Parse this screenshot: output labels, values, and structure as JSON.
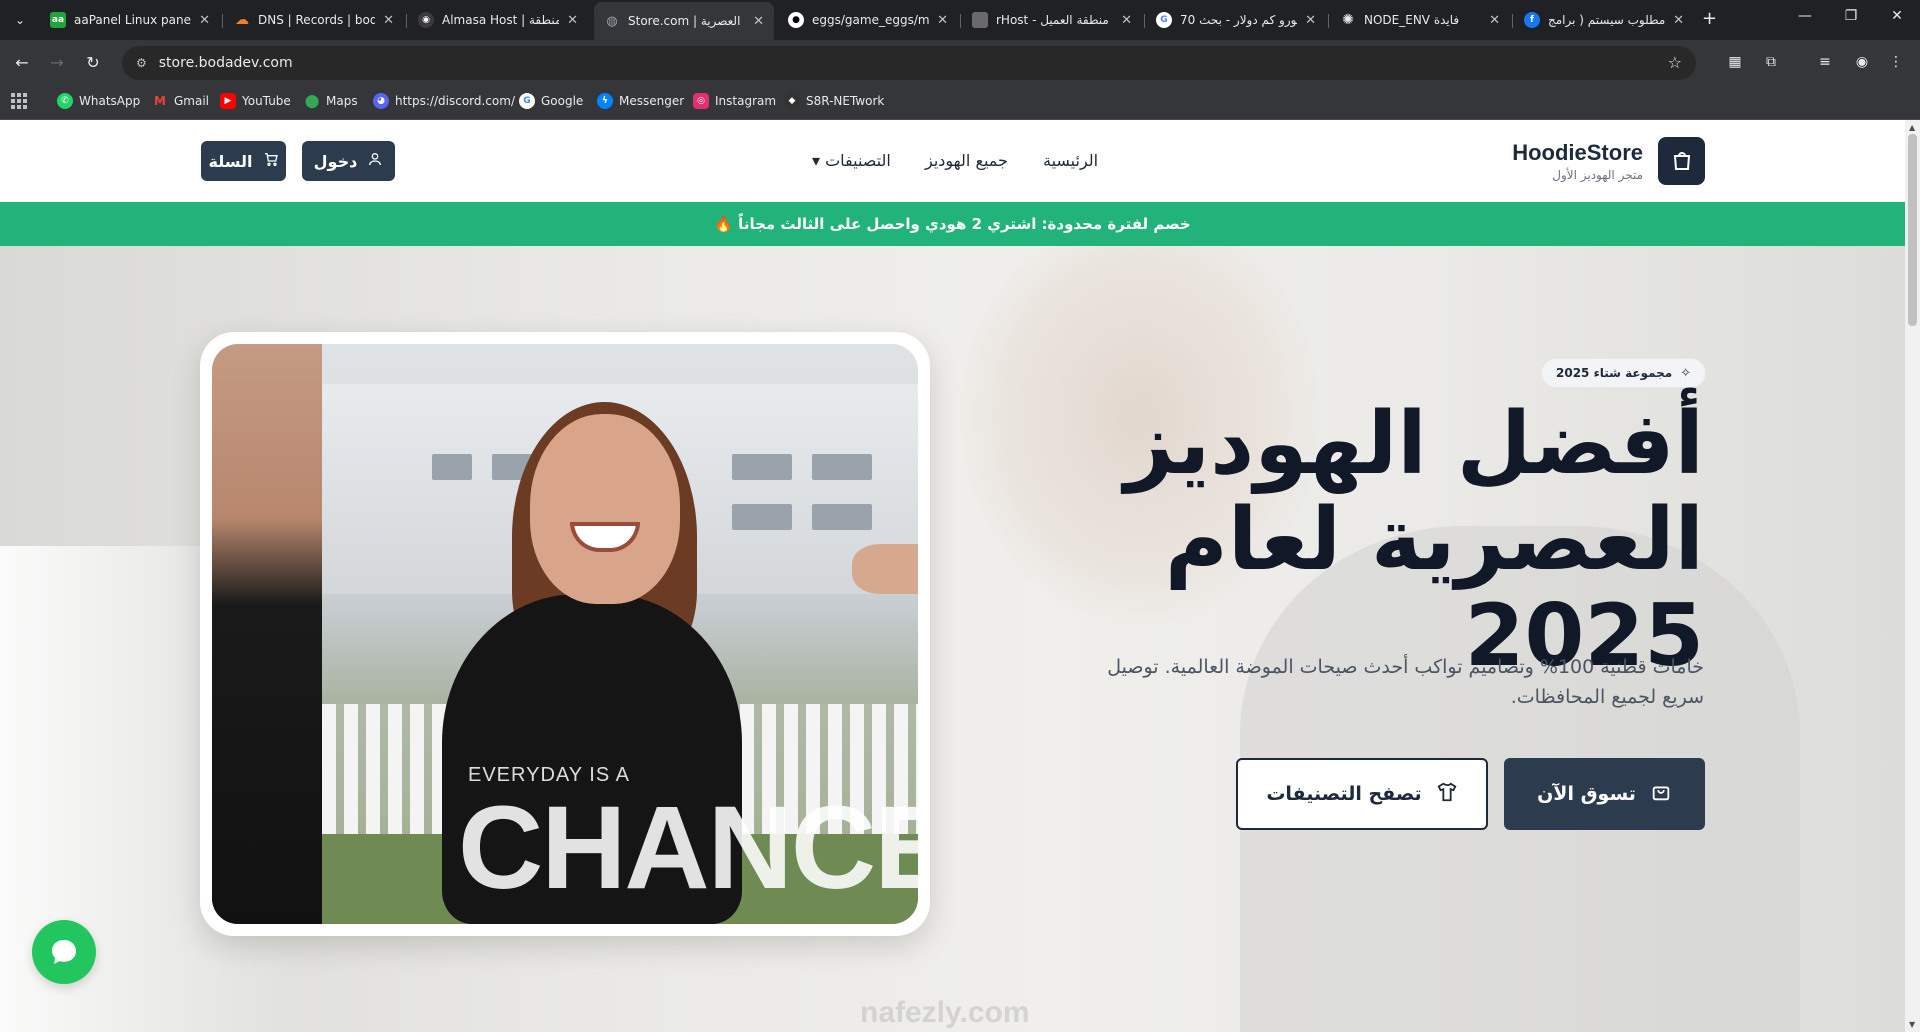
{
  "browser": {
    "tabs": [
      {
        "title": "aaPanel Linux panel -",
        "favicon": "aapanel-icon",
        "color": "#20a53a",
        "glyph": "aa"
      },
      {
        "title": "DNS | Records | boda",
        "favicon": "cloudflare-icon",
        "color": "#f38020",
        "glyph": ""
      },
      {
        "title": "Almasa Host | منطقة",
        "favicon": "almasa-icon",
        "color": "#3b3b3b",
        "glyph": ""
      },
      {
        "title": "Store.com | العصرية",
        "favicon": "globe-icon",
        "color": "#9aa0a6",
        "glyph": ""
      },
      {
        "title": "eggs/game_eggs/mi",
        "favicon": "github-icon",
        "color": "#ffffff",
        "glyph": ""
      },
      {
        "title": "rHost - منطقة العميل",
        "favicon": "host-icon",
        "color": "#a0a0a0",
        "glyph": ""
      },
      {
        "title": "70 يورو كم دولار - بحث",
        "favicon": "google-icon",
        "color": "#ffffff",
        "glyph": "G"
      },
      {
        "title": "NODE_ENV فايدة",
        "favicon": "openai-icon",
        "color": "#e8eaed",
        "glyph": ""
      },
      {
        "title": "مطلوب سيستم ( برامج",
        "favicon": "facebook-icon",
        "color": "#1877f2",
        "glyph": "f"
      }
    ],
    "url": "store.bodadev.com",
    "bookmarks": [
      {
        "label": "WhatsApp",
        "icon": "whatsapp-icon",
        "color": "#25d366"
      },
      {
        "label": "Gmail",
        "icon": "gmail-icon",
        "color": "#ea4335"
      },
      {
        "label": "YouTube",
        "icon": "youtube-icon",
        "color": "#ff0000"
      },
      {
        "label": "Maps",
        "icon": "maps-icon",
        "color": "#34a853"
      },
      {
        "label": "https://discord.com/",
        "icon": "discord-icon",
        "color": "#5865f2"
      },
      {
        "label": "Google",
        "icon": "google-icon",
        "color": "#ffffff"
      },
      {
        "label": "Messenger",
        "icon": "messenger-icon",
        "color": "#0084ff"
      },
      {
        "label": "Instagram",
        "icon": "instagram-icon",
        "color": "#e1306c"
      },
      {
        "label": "S8R-NETwork",
        "icon": "s8r-icon",
        "color": "#333333"
      }
    ]
  },
  "site": {
    "brand_name": "HoodieStore",
    "brand_tagline": "متجر الهوديز الأول",
    "nav": {
      "home": "الرئيسية",
      "all": "جميع الهوديز",
      "categories": "التصنيفات ▾"
    },
    "login_label": "دخول",
    "cart_label": "السلة",
    "promo": "خصم لفترة محدودة: اشتري 2 هودي واحصل على الثالث مجاناً 🔥",
    "hero": {
      "badge": "مجموعة شتاء 2025",
      "title": "أفضل الهوديز العصرية لعام 2025",
      "subtitle": "خامات قطنية 100% وتصاميم تواكب أحدث صيحات الموضة العالمية. توصيل سريع لجميع المحافظات.",
      "cta_primary": "تسوق الآن",
      "cta_secondary": "تصفح التصنيفات",
      "photo_text_small": "EVERYDAY IS A",
      "photo_text_big": "CHANCE",
      "watermark": "nafezly.com"
    },
    "accent_color": "#22b37a",
    "dark_color": "#2d3b4e"
  }
}
